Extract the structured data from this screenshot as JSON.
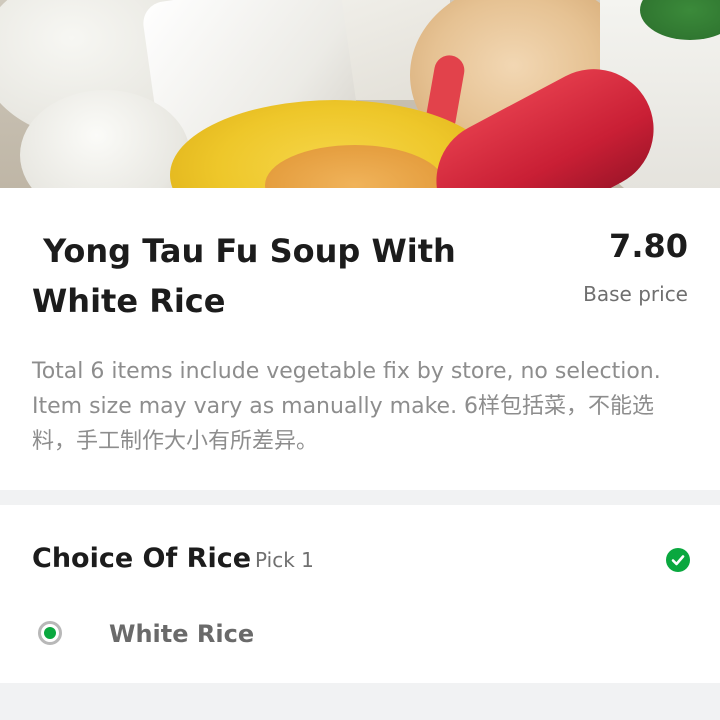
{
  "hero": {
    "image_label": "food-photo"
  },
  "item": {
    "title": " Yong Tau Fu Soup With\nWhite Rice",
    "price": "7.80",
    "price_caption": "Base price",
    "description": "Total 6 items include vegetable fix by store, no selection. Item size may vary as manually make. 6样包括菜，不能选料，手工制作大小有所差异。"
  },
  "options": {
    "group_title": "Choice Of Rice",
    "group_rule": "Pick 1",
    "status_icon": "check-circle-icon",
    "items": [
      {
        "label": "White Rice",
        "selected": true
      }
    ]
  },
  "colors": {
    "accent": "#0aa83f",
    "title_text": "#1c1c1c",
    "muted_text": "#8d8d8d",
    "background": "#f1f2f3"
  }
}
